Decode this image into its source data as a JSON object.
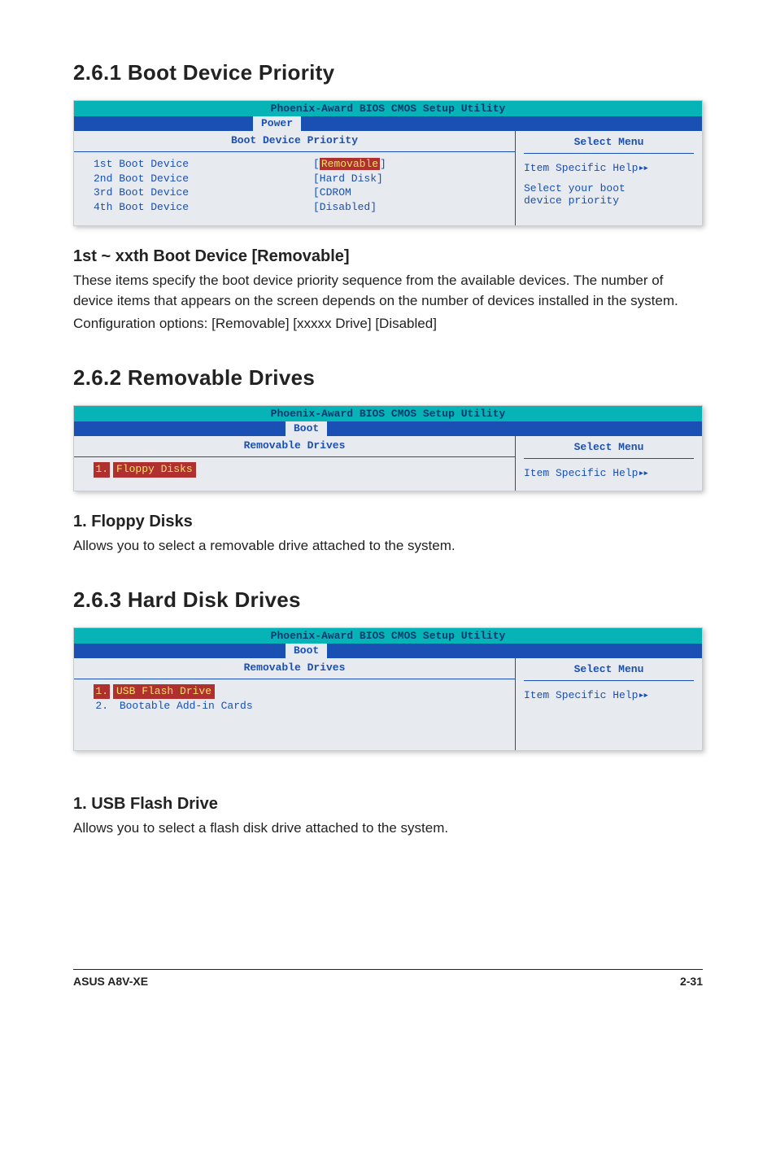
{
  "sections": {
    "s261": {
      "title": "2.6.1  Boot Device Priority",
      "bios": {
        "utility_title": "Phoenix-Award BIOS CMOS Setup Utility",
        "active_tab": "Power",
        "panel_title": "Boot Device Priority",
        "select_menu": "Select Menu",
        "help_line": "Item Specific Help",
        "help_arrows": "▸▸",
        "help_body1": "Select your boot",
        "help_body2": "device priority",
        "rows": [
          {
            "label": "1st Boot Device",
            "value": "Removable",
            "selected": true,
            "bracketed": true
          },
          {
            "label": "2nd Boot Device",
            "value": "[Hard Disk]",
            "selected": false
          },
          {
            "label": "3rd Boot Device",
            "value": "[CDROM",
            "selected": false
          },
          {
            "label": "4th Boot Device",
            "value": "[Disabled]",
            "selected": false
          }
        ]
      },
      "sub": {
        "heading": "1st ~ xxth Boot Device [Removable]",
        "p1": "These items specify the boot device priority sequence from the available devices. The number of device items that appears on the screen depends on the number of devices installed in the system.",
        "p2": "Configuration options:  [Removable] [xxxxx Drive] [Disabled]"
      }
    },
    "s262": {
      "title": "2.6.2  Removable Drives",
      "bios": {
        "utility_title": "Phoenix-Award BIOS CMOS Setup Utility",
        "active_tab": "Boot",
        "panel_title": "Removable Drives",
        "select_menu": "Select Menu",
        "help_line": "Item Specific Help",
        "help_arrows": "▸▸",
        "items": [
          {
            "num": "1.",
            "text": "Floppy Disks",
            "selected": true
          }
        ]
      },
      "sub": {
        "heading": "1. Floppy Disks",
        "p1": "Allows you to select a removable drive attached to the system."
      }
    },
    "s263": {
      "title": "2.6.3  Hard Disk Drives",
      "bios": {
        "utility_title": "Phoenix-Award BIOS CMOS Setup Utility",
        "active_tab": "Boot",
        "panel_title": "Removable Drives",
        "select_menu": "Select Menu",
        "help_line": "Item Specific Help",
        "help_arrows": "▸▸",
        "items": [
          {
            "num": "1.",
            "text": "USB Flash Drive",
            "selected": true
          },
          {
            "num": "2.",
            "text": "Bootable Add-in Cards",
            "selected": false
          }
        ]
      },
      "sub": {
        "heading": "1. USB Flash Drive",
        "p1": "Allows you to select a flash disk drive attached to the system."
      }
    }
  },
  "footer": {
    "left": "ASUS A8V-XE",
    "right": "2-31"
  }
}
